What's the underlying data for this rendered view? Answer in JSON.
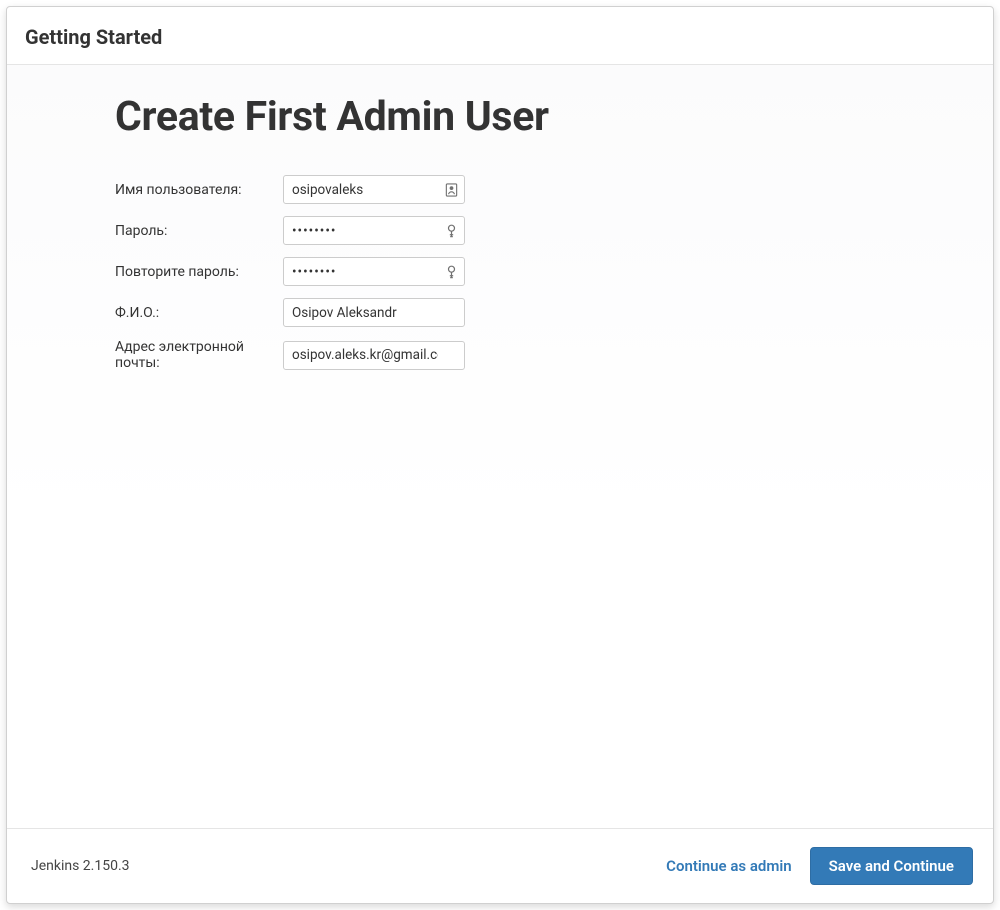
{
  "header": {
    "title": "Getting Started"
  },
  "page": {
    "heading": "Create First Admin User"
  },
  "form": {
    "username": {
      "label": "Имя пользователя:",
      "value": "osipovaleks"
    },
    "password": {
      "label": "Пароль:",
      "value": "••••••••"
    },
    "passwordConfirm": {
      "label": "Повторите пароль:",
      "value": "••••••••"
    },
    "fullName": {
      "label": "Ф.И.О.:",
      "value": "Osipov Aleksandr"
    },
    "email": {
      "label": "Адрес электронной почты:",
      "value": "osipov.aleks.kr@gmail.com"
    }
  },
  "footer": {
    "version": "Jenkins 2.150.3",
    "continueAsAdmin": "Continue as admin",
    "saveAndContinue": "Save and Continue"
  }
}
